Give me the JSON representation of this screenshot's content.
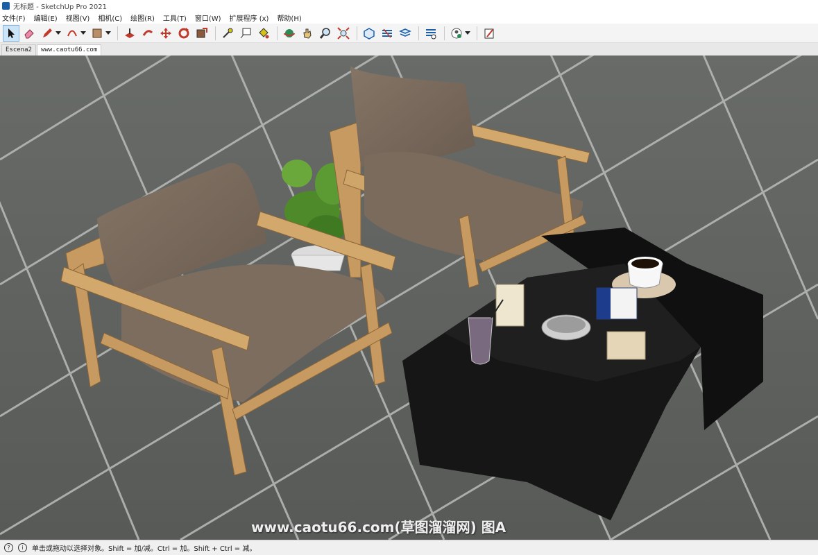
{
  "window": {
    "title": "无标题 - SketchUp Pro 2021"
  },
  "menu": [
    "文件(F)",
    "编辑(E)",
    "视图(V)",
    "相机(C)",
    "绘图(R)",
    "工具(T)",
    "窗口(W)",
    "扩展程序 (x)",
    "帮助(H)"
  ],
  "toolbar": {
    "tools": [
      "select-icon",
      "eraser-icon",
      "pencil-icon",
      "arc-icon",
      "rectangle-icon",
      "push-pull-icon",
      "follow-me-icon",
      "move-icon",
      "rotate-icon",
      "scale-icon",
      "tape-measure-icon",
      "text-icon",
      "paint-bucket-icon",
      "orbit-icon",
      "pan-icon",
      "zoom-icon",
      "zoom-extents-icon",
      "warehouse-icon",
      "extension-warehouse-icon",
      "layout-icon",
      "extension-manager-icon",
      "account-icon",
      "feedback-icon"
    ]
  },
  "scene_tabs": [
    "Escena2",
    "www.caotu66.com"
  ],
  "active_tab": 1,
  "status": {
    "text": "单击或拖动以选择对象。Shift = 加/减。Ctrl = 加。Shift + Ctrl = 减。"
  },
  "watermark": {
    "text": "www.caotu66.com(草图溜溜网) 图A"
  },
  "colors": {
    "accent": "#1b5fa8",
    "floor": "#5f625f",
    "wood": "#c9a06a",
    "cushion": "#7a6a5c",
    "table": "#151515"
  }
}
